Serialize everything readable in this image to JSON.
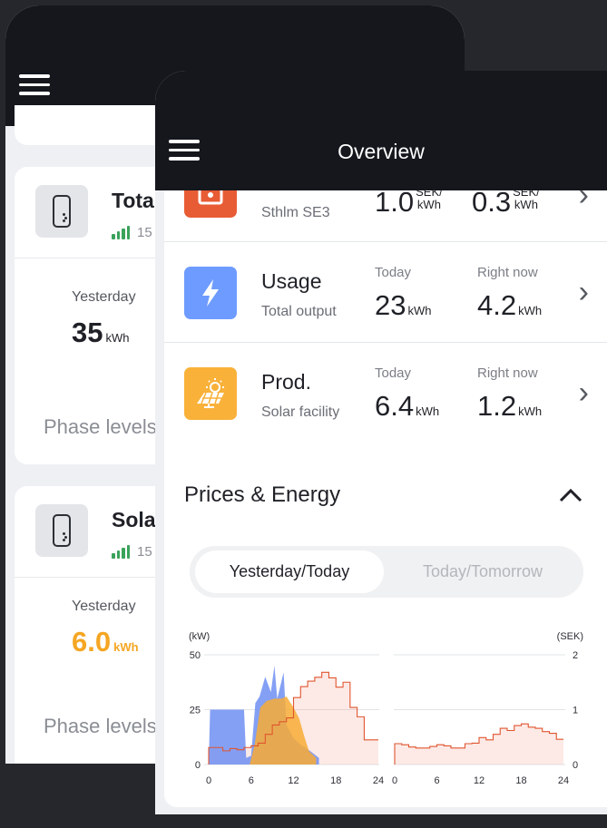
{
  "back": {
    "cards": [
      {
        "title": "Tota",
        "signal": "15",
        "yesterday_label": "Yesterday",
        "yesterday_value": "35",
        "yesterday_unit": "kWh",
        "phase": "Phase levels"
      },
      {
        "title": "Sola",
        "signal": "15",
        "yesterday_label": "Yesterday",
        "yesterday_value": "6.0",
        "yesterday_unit": "kWh",
        "phase": "Phase levels"
      }
    ]
  },
  "front": {
    "title": "Overview",
    "rows": [
      {
        "name": "",
        "sub": "Sthlm SE3",
        "left_label": "",
        "left_value": "1.0",
        "left_unit_top": "SEK/",
        "left_unit_bottom": "kWh",
        "right_label": "",
        "right_value": "0.3",
        "right_unit_top": "SEK/",
        "right_unit_bottom": "kWh"
      },
      {
        "name": "Usage",
        "sub": "Total output",
        "left_label": "Today",
        "left_value": "23",
        "left_unit": "kWh",
        "right_label": "Right now",
        "right_value": "4.2",
        "right_unit": "kWh"
      },
      {
        "name": "Prod.",
        "sub": "Solar facility",
        "left_label": "Today",
        "left_value": "6.4",
        "left_unit": "kWh",
        "right_label": "Right now",
        "right_value": "1.2",
        "right_unit": "kWh"
      }
    ],
    "section_title": "Prices & Energy",
    "tabs": [
      "Yesterday/Today",
      "Today/Tomorrow"
    ],
    "colors": {
      "price_icon": "#e85c35",
      "usage_icon": "#6e9bff",
      "solar_icon": "#f9b13a",
      "usage_series": "#6f8ff2",
      "solar_series": "#f7ac35",
      "price_line": "#e0552f"
    }
  },
  "chart_data": {
    "type": "area",
    "left_axis_label": "(kW)",
    "right_axis_label": "(SEK)",
    "left_ticks": [
      0,
      25,
      50
    ],
    "right_ticks": [
      0,
      1,
      2
    ],
    "ylim_left": [
      0,
      50
    ],
    "ylim_right": [
      0,
      2
    ],
    "panels": [
      {
        "x_ticks": [
          0,
          6,
          12,
          18,
          24
        ],
        "usage_kw": [
          [
            0,
            0
          ],
          [
            0.2,
            25
          ],
          [
            5,
            25
          ],
          [
            5.3,
            3
          ],
          [
            6,
            4
          ],
          [
            6.6,
            28
          ],
          [
            7.2,
            31
          ],
          [
            8,
            40
          ],
          [
            8.8,
            33
          ],
          [
            9.3,
            45
          ],
          [
            9.7,
            30
          ],
          [
            10.6,
            42
          ],
          [
            11,
            18
          ],
          [
            12,
            12
          ],
          [
            13,
            9
          ],
          [
            14,
            7
          ],
          [
            15.6,
            3
          ],
          [
            15.6,
            0
          ]
        ],
        "solar_kw": [
          [
            5.8,
            0
          ],
          [
            6.5,
            9
          ],
          [
            7.3,
            26
          ],
          [
            8.2,
            29
          ],
          [
            9.3,
            30
          ],
          [
            10.3,
            30
          ],
          [
            11,
            31
          ],
          [
            12,
            26
          ],
          [
            12.8,
            21
          ],
          [
            13.5,
            13
          ],
          [
            14.2,
            6
          ],
          [
            15.2,
            3
          ],
          [
            15.2,
            0
          ]
        ],
        "price_sek": [
          0.31,
          0.31,
          0.25,
          0.29,
          0.27,
          0.31,
          0.34,
          0.39,
          0.55,
          0.72,
          0.78,
          0.85,
          1.22,
          1.42,
          1.52,
          1.59,
          1.68,
          1.58,
          1.41,
          1.5,
          1.04,
          0.87,
          0.45,
          0.45
        ]
      },
      {
        "x_ticks": [
          0,
          6,
          12,
          18,
          24
        ],
        "price_sek": [
          0.38,
          0.36,
          0.32,
          0.3,
          0.3,
          0.33,
          0.36,
          0.34,
          0.3,
          0.3,
          0.38,
          0.39,
          0.49,
          0.45,
          0.55,
          0.66,
          0.62,
          0.71,
          0.74,
          0.68,
          0.66,
          0.6,
          0.57,
          0.46
        ]
      }
    ]
  }
}
